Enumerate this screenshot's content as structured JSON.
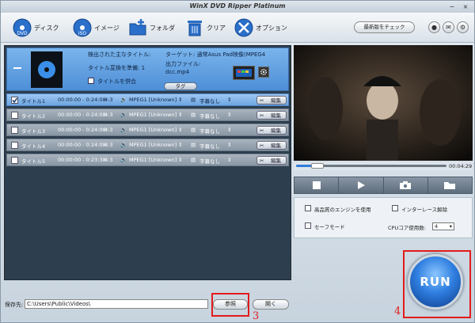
{
  "window": {
    "title": "WinX DVD Ripper Platinum",
    "minimize_glyph": "−",
    "close_glyph": "×"
  },
  "toolbar": {
    "disc_label": "ディスク",
    "image_label": "イメージ",
    "folder_label": "フォルダ",
    "clear_label": "クリア",
    "options_label": "オプション",
    "update_label": "最新版をチェック",
    "user_icon": "user-icon",
    "mail_icon": "mail-icon",
    "settings_icon": "settings-icon"
  },
  "source": {
    "main_title_label": "検出された主なタイトル:",
    "ready_label": "タイトル変換を準備: 1",
    "merge_label": "タイトルを併合",
    "target_label": "ターゲット: 通常Asus Pad映像(MPEG4",
    "output_label": "出力ファイル:",
    "output_file": "dcc.mp4",
    "tag_label": "タグ"
  },
  "titles": [
    {
      "name": "タイトル1",
      "range": "00:00:00 - 0:24:08",
      "aspect": "4:3",
      "audio": "MPEG1 [Unknown]",
      "subtitle": "字幕なし",
      "edit": "編集",
      "checked": true
    },
    {
      "name": "タイトル2",
      "range": "00:00:00 - 0:24:08",
      "aspect": "4:3",
      "audio": "MPEG1 [Unknown]",
      "subtitle": "字幕なし",
      "edit": "編集",
      "checked": false
    },
    {
      "name": "タイトル3",
      "range": "00:00:00 - 0:24:08",
      "aspect": "4:3",
      "audio": "MPEG1 [Unknown]",
      "subtitle": "字幕なし",
      "edit": "編集",
      "checked": false
    },
    {
      "name": "タイトル4",
      "range": "00:00:00 - 0:24:08",
      "aspect": "4:3",
      "audio": "MPEG1 [Unknown]",
      "subtitle": "字幕なし",
      "edit": "編集",
      "checked": false
    },
    {
      "name": "タイトル5",
      "range": "00:00:00 - 0:23:38",
      "aspect": "4:3",
      "audio": "MPEG1 [Unknown]",
      "subtitle": "字幕なし",
      "edit": "編集",
      "checked": false
    }
  ],
  "player": {
    "time": "00:04:29",
    "progress": 0.1
  },
  "options": {
    "hq_engine": "高品質のエンジンを使用",
    "deinterlace": "インターレース解除",
    "safe_mode": "セーフモード",
    "cpu_label": "CPUコア使用数:",
    "cpu_value": "4"
  },
  "bottom": {
    "save_label": "保存先:",
    "save_path": "C:\\Users\\Public\\Videos\\",
    "browse_label": "参照",
    "open_label": "開く"
  },
  "run_label": "RUN",
  "annotations": {
    "browse_number": "3",
    "run_number": "4"
  },
  "colors": {
    "accent": "#2f7ddc",
    "highlight": "#e21b1b",
    "panel": "#2d3e4e"
  }
}
